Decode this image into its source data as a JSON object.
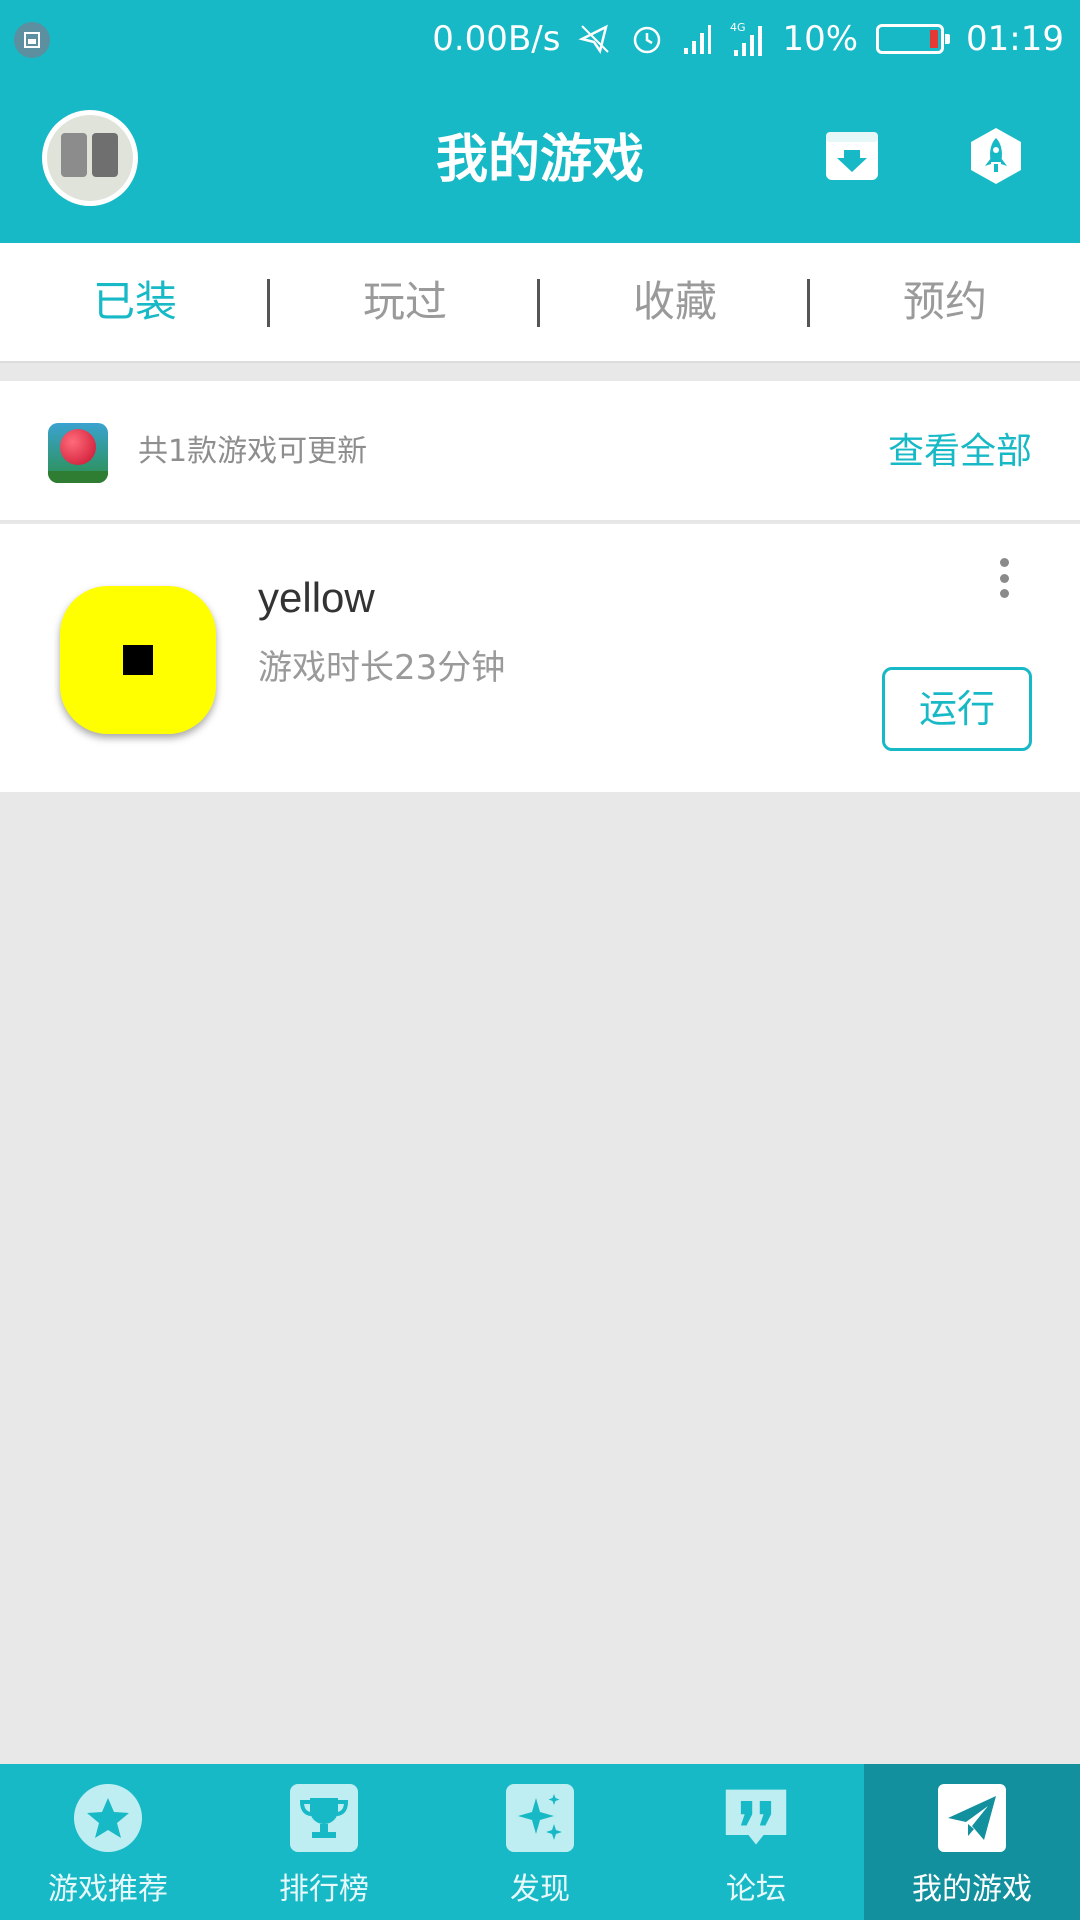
{
  "status_bar": {
    "net_speed": "0.00B/s",
    "battery_percent": "10%",
    "time": "01:19",
    "network_type": "4G",
    "icons": [
      "screenshot-icon",
      "silent-icon",
      "alarm-icon",
      "signal-icon",
      "signal-4g-icon",
      "battery-icon"
    ]
  },
  "header": {
    "title": "我的游戏",
    "icons": [
      "avatar",
      "download-box-icon",
      "rocket-icon"
    ]
  },
  "tabs": [
    {
      "label": "已装",
      "active": true
    },
    {
      "label": "玩过",
      "active": false
    },
    {
      "label": "收藏",
      "active": false
    },
    {
      "label": "预约",
      "active": false
    }
  ],
  "update_banner": {
    "text": "共1款游戏可更新",
    "link": "查看全部"
  },
  "games": [
    {
      "name": "yellow",
      "playtime": "游戏时长23分钟",
      "action": "运行"
    }
  ],
  "bottom_nav": [
    {
      "label": "游戏推荐",
      "icon": "star-icon",
      "active": false
    },
    {
      "label": "排行榜",
      "icon": "trophy-icon",
      "active": false
    },
    {
      "label": "发现",
      "icon": "sparkle-icon",
      "active": false
    },
    {
      "label": "论坛",
      "icon": "quote-icon",
      "active": false
    },
    {
      "label": "我的游戏",
      "icon": "paper-plane-icon",
      "active": true
    }
  ],
  "colors": {
    "accent": "#17b9c6",
    "nav_active": "#12909d",
    "background": "#e8e8e8",
    "game_icon": "#ffff00"
  }
}
